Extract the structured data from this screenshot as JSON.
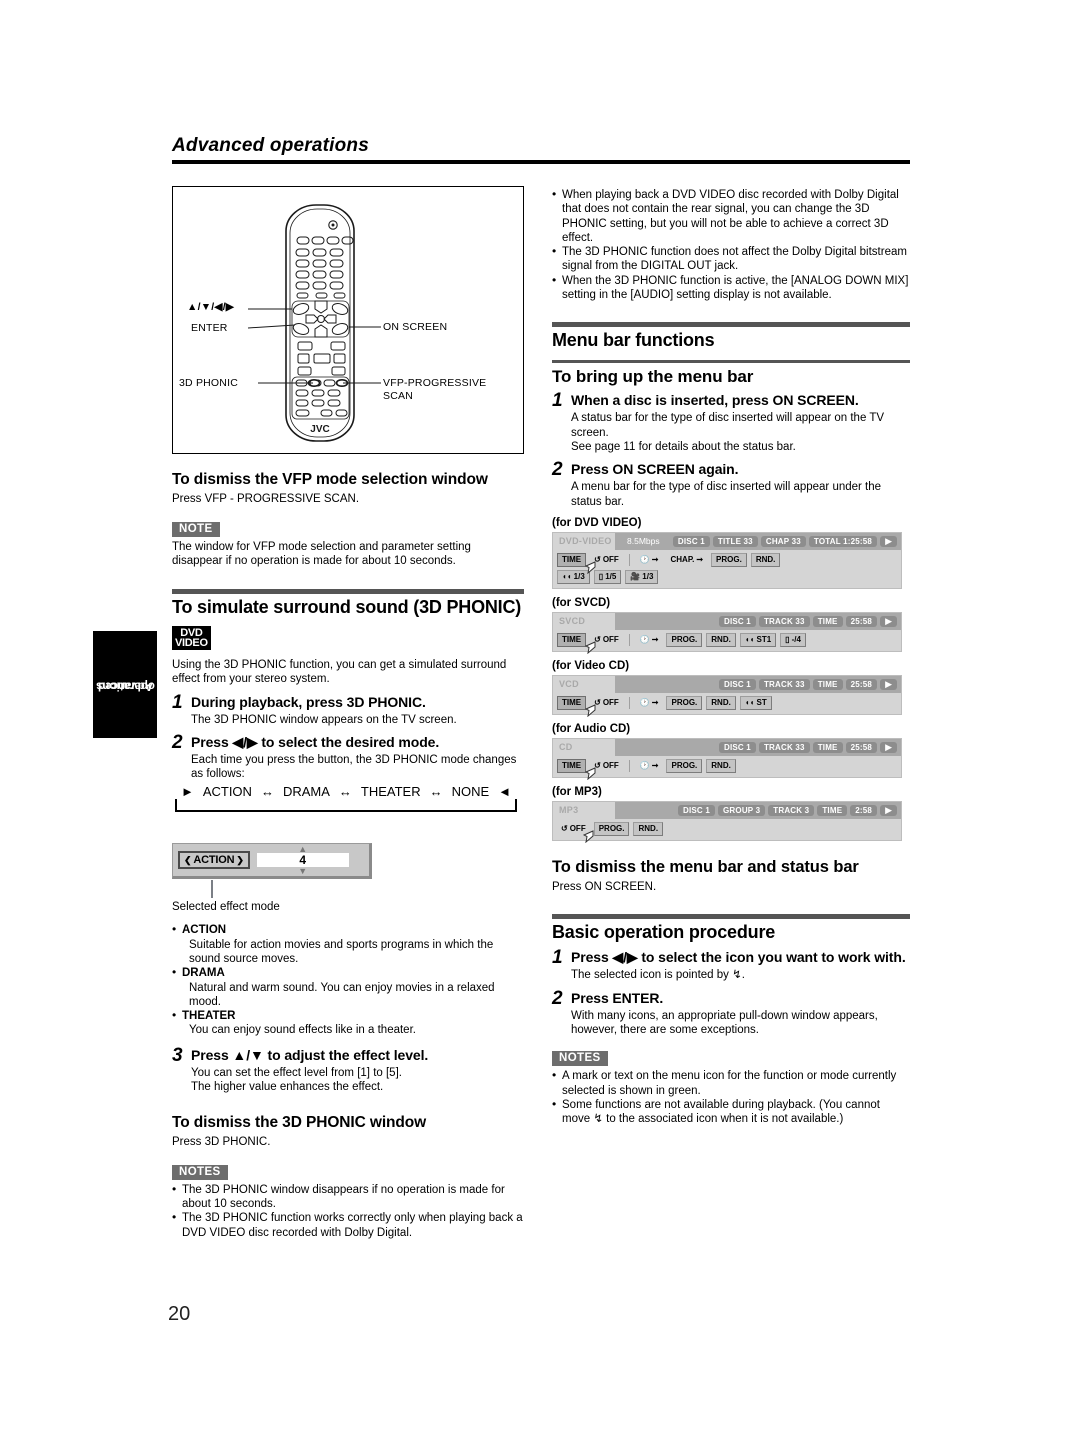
{
  "header": {
    "title": "Advanced operations"
  },
  "side_tab": {
    "line1": "Advanced",
    "line2": "operations"
  },
  "page_number": "20",
  "remote_figure": {
    "labels": {
      "arrows": "▲/▼/◀/▶",
      "enter": "ENTER",
      "phonic_3d": "3D PHONIC",
      "on_screen": "ON SCREEN",
      "vfp_line1": "VFP-PROGRESSIVE",
      "vfp_line2": "SCAN",
      "brand": "JVC"
    }
  },
  "left_column": {
    "dismiss_vfp": {
      "heading": "To dismiss the VFP mode selection window",
      "body": "Press VFP - PROGRESSIVE SCAN.",
      "note_badge": "NOTE",
      "note_text": "The window for VFP mode selection and parameter setting disappear if no operation is made for about 10 seconds."
    },
    "phonic_section": {
      "heading": "To simulate surround sound (3D PHONIC)",
      "disc_badge_line1": "DVD",
      "disc_badge_line2": "VIDEO",
      "intro": "Using the 3D PHONIC function, you can get a simulated surround effect from your stereo system.",
      "steps": [
        {
          "num": "1",
          "head": "During playback, press 3D PHONIC.",
          "text": "The 3D PHONIC window appears on the TV screen."
        },
        {
          "num": "2",
          "head": "Press ◀/▶ to select the desired mode.",
          "text": "Each time you press the button, the 3D PHONIC mode changes as follows:"
        },
        {
          "num": "3",
          "head": "Press ▲/▼ to adjust the effect level.",
          "text": "You can set the effect level from [1] to [5].\nThe higher value enhances the effect."
        }
      ],
      "cycle": [
        "ACTION",
        "DRAMA",
        "THEATER",
        "NONE"
      ],
      "effect_window": {
        "mode_label": "ACTION",
        "level_value": "4",
        "caption": "Selected effect mode"
      },
      "modes": [
        {
          "name": "ACTION",
          "desc": "Suitable for action movies and sports programs in which the sound source moves."
        },
        {
          "name": "DRAMA",
          "desc": "Natural and warm sound. You can enjoy movies in a relaxed mood."
        },
        {
          "name": "THEATER",
          "desc": "You can enjoy sound effects like in a theater."
        }
      ]
    },
    "dismiss_phonic": {
      "heading": "To dismiss the 3D PHONIC window",
      "body": "Press 3D PHONIC.",
      "note_badge": "NOTES",
      "notes": [
        "The 3D PHONIC window disappears if no operation is made for about 10 seconds.",
        "The 3D PHONIC function works correctly only when playing back a DVD VIDEO disc recorded with Dolby Digital."
      ]
    }
  },
  "right_column": {
    "top_notes": [
      "When playing back a DVD VIDEO disc recorded with Dolby Digital that does not contain the rear signal, you can change the 3D PHONIC setting, but you will not be able to achieve a correct 3D effect.",
      "The 3D PHONIC function does not affect the Dolby Digital bitstream signal from the DIGITAL OUT jack.",
      "When the 3D PHONIC function is active, the [ANALOG DOWN MIX] setting in the [AUDIO] setting display is not available."
    ],
    "menu_bar_functions": {
      "heading": "Menu bar functions",
      "bring_up": {
        "heading": "To bring up the menu bar",
        "steps": [
          {
            "num": "1",
            "head": "When a disc is inserted, press ON SCREEN.",
            "text": "A status bar for the type of disc inserted will appear on the TV screen.\nSee page 11 for details about the status bar."
          },
          {
            "num": "2",
            "head": "Press ON SCREEN again.",
            "text": "A menu bar for the type of disc inserted will appear under the status bar."
          }
        ]
      },
      "dismiss": {
        "heading": "To dismiss the menu bar and status bar",
        "body": "Press ON SCREEN."
      }
    },
    "basic_operation": {
      "heading": "Basic operation procedure",
      "steps": [
        {
          "num": "1",
          "head": "Press ◀/▶ to select the icon you want to work with.",
          "text": "The selected icon is pointed by ↯."
        },
        {
          "num": "2",
          "head": "Press ENTER.",
          "text": "With many icons, an appropriate pull-down window appears, however, there are some exceptions."
        }
      ],
      "note_badge": "NOTES",
      "notes": [
        "A mark or text on the menu icon for the function or mode currently selected is shown in green.",
        "Some functions are not available during playback. (You cannot move ↯ to the associated icon when it is not available.)"
      ]
    },
    "menu_bars": [
      {
        "caption": "(for DVD VIDEO)",
        "type": "DVD-VIDEO",
        "rate": "8.5Mbps",
        "chips": [
          "DISC 1",
          "TITLE 33",
          "CHAP 33",
          "TOTAL 1:25:58"
        ],
        "row2": [
          "TIME",
          "OFF",
          "clock",
          "CHAP.",
          "PROG.",
          "RND."
        ],
        "row3": [
          "1/3",
          "1/5",
          "1/3"
        ]
      },
      {
        "caption": "(for SVCD)",
        "type": "SVCD",
        "rate": "",
        "chips": [
          "DISC 1",
          "TRACK 33",
          "TIME",
          "25:58"
        ],
        "row2": [
          "TIME",
          "OFF",
          "clock",
          "PROG.",
          "RND.",
          "ST1",
          "-/4"
        ],
        "row3": []
      },
      {
        "caption": "(for Video CD)",
        "type": "VCD",
        "rate": "",
        "chips": [
          "DISC 1",
          "TRACK 33",
          "TIME",
          "25:58"
        ],
        "row2": [
          "TIME",
          "OFF",
          "clock",
          "PROG.",
          "RND.",
          "ST"
        ],
        "row3": []
      },
      {
        "caption": "(for Audio CD)",
        "type": "CD",
        "rate": "",
        "chips": [
          "DISC 1",
          "TRACK 33",
          "TIME",
          "25:58"
        ],
        "row2": [
          "TIME",
          "OFF",
          "clock",
          "PROG.",
          "RND."
        ],
        "row3": []
      },
      {
        "caption": "(for MP3)",
        "type": "MP3",
        "rate": "",
        "chips": [
          "DISC 1",
          "GROUP 3",
          "TRACK 3",
          "TIME",
          "2:58"
        ],
        "row2": [
          "OFF",
          "PROG.",
          "RND."
        ],
        "row3": []
      }
    ]
  }
}
